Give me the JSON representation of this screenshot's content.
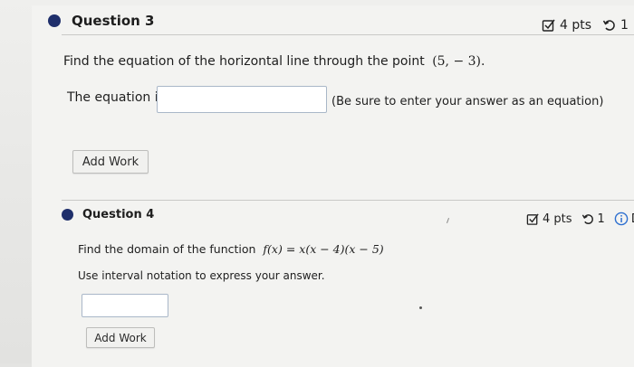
{
  "q3": {
    "title": "Question 3",
    "pts": "4 pts",
    "retry_count": "1",
    "prompt_prefix": "Find the equation of the horizontal line through the point",
    "prompt_point": "(5, − 3).",
    "answer_label": "The equation is",
    "answer_value": "",
    "answer_hint": "(Be sure to enter your answer as an equation)",
    "add_work": "Add Work"
  },
  "q4": {
    "title": "Question 4",
    "pts": "4 pts",
    "retry_count": "1",
    "details_fragment": "De",
    "prompt_prefix": "Find the domain of the function",
    "prompt_func": "f(x) = x(x − 4)(x − 5)",
    "instruction": "Use interval notation to express your answer.",
    "answer_value": "",
    "add_work": "Add Work"
  },
  "colors": {
    "bullet": "#1f2f6b",
    "box_border": "#a9b7c8"
  },
  "icons": [
    "checkbox-edit-icon",
    "retry-icon",
    "info-icon"
  ]
}
